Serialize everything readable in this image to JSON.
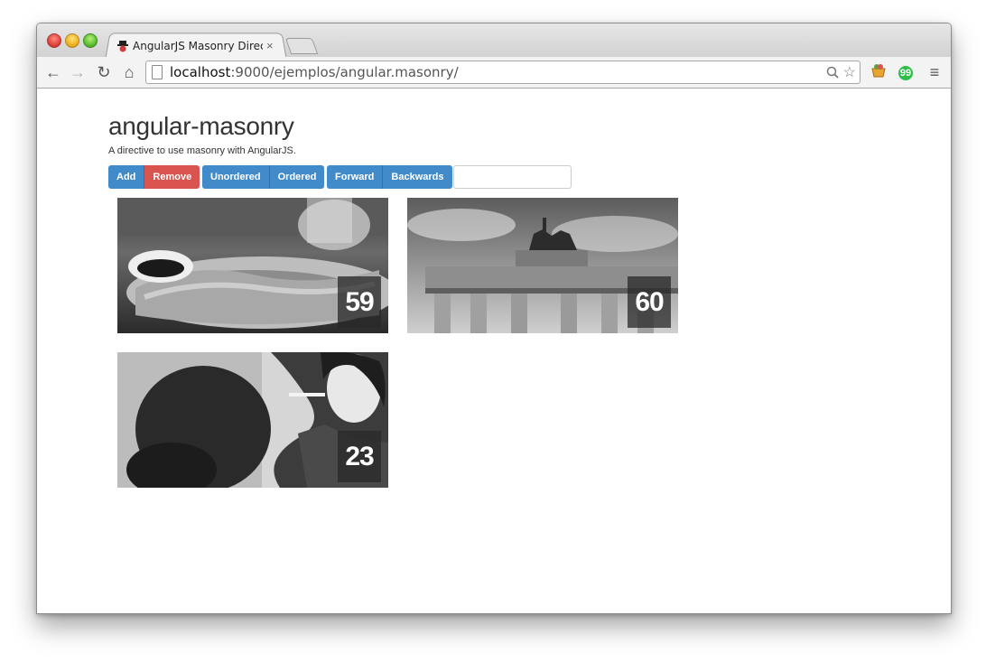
{
  "browser": {
    "tab_title": "AngularJS Masonry Directive",
    "tab_close": "×",
    "url_host": "localhost",
    "url_path": ":9000/ejemplos/angular.masonry/",
    "icons": {
      "back": "←",
      "forward": "→",
      "reload": "↻",
      "home": "⌂",
      "zoom": "🔍",
      "star": "☆",
      "menu": "≡"
    }
  },
  "page": {
    "title": "angular-masonry",
    "subtitle": "A directive to use masonry with AngularJS."
  },
  "controls": {
    "add": "Add",
    "remove": "Remove",
    "unordered": "Unordered",
    "ordered": "Ordered",
    "forward": "Forward",
    "backwards": "Backwards",
    "filter_value": ""
  },
  "bricks": [
    {
      "number": "59",
      "image": "food-plate-photo"
    },
    {
      "number": "60",
      "image": "brandenburg-gate-photo"
    },
    {
      "number": "23",
      "image": "woman-portrait-photo"
    }
  ],
  "colors": {
    "primary": "#428bca",
    "danger": "#d9534f"
  }
}
